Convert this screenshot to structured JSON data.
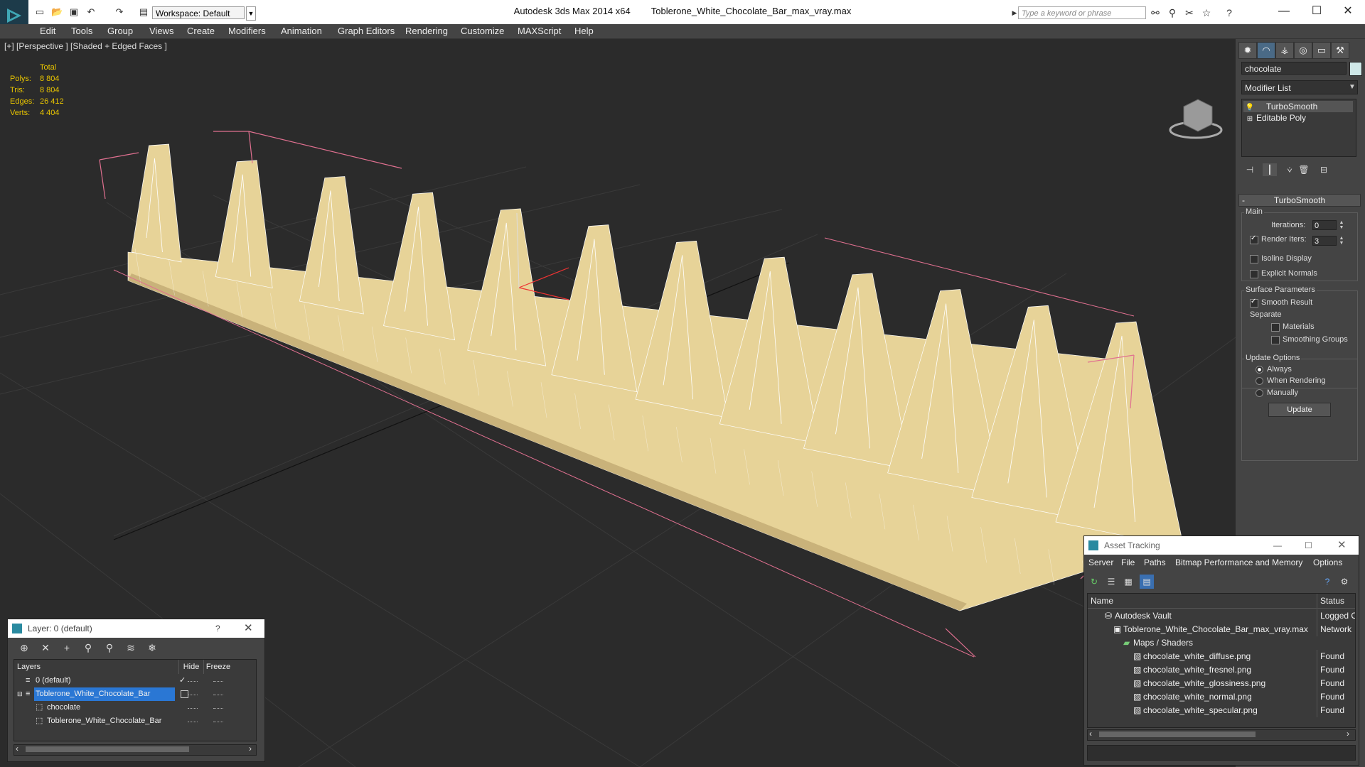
{
  "app": {
    "title": "Autodesk 3ds Max  2014 x64",
    "file": "Toblerone_White_Chocolate_Bar_max_vray.max",
    "workspace": "Workspace: Default",
    "search_placeholder": "Type a keyword or phrase"
  },
  "menu": [
    "Edit",
    "Tools",
    "Group",
    "Views",
    "Create",
    "Modifiers",
    "Animation",
    "Graph Editors",
    "Rendering",
    "Customize",
    "MAXScript",
    "Help"
  ],
  "viewport": {
    "label": "[+] [Perspective ] [Shaded + Edged Faces ]",
    "stats": {
      "header": "Total",
      "rows": [
        {
          "label": "Polys:",
          "value": "8 804"
        },
        {
          "label": "Tris:",
          "value": "8 804"
        },
        {
          "label": "Edges:",
          "value": "26 412"
        },
        {
          "label": "Verts:",
          "value": "4 404"
        }
      ]
    },
    "object_color": "#e7d398"
  },
  "command_panel": {
    "object_name": "chocolate",
    "modifier_list": "Modifier List",
    "stack": [
      "TurboSmooth",
      "Editable Poly"
    ],
    "rollout_title": "TurboSmooth",
    "main_group": "Main",
    "iterations_label": "Iterations:",
    "iterations_value": "0",
    "render_iters_label": "Render Iters:",
    "render_iters_value": "3",
    "isoline_label": "Isoline Display",
    "explicit_normals_label": "Explicit Normals",
    "surface_group": "Surface Parameters",
    "smooth_result_label": "Smooth Result",
    "separate_label": "Separate",
    "materials_label": "Materials",
    "smoothing_groups_label": "Smoothing Groups",
    "update_group": "Update Options",
    "always_label": "Always",
    "when_rendering_label": "When Rendering",
    "manually_label": "Manually",
    "update_button": "Update"
  },
  "layer_dialog": {
    "title": "Layer: 0 (default)",
    "help": "?",
    "columns": {
      "layers": "Layers",
      "hide": "Hide",
      "freeze": "Freeze"
    },
    "rows": [
      "0 (default)",
      "Toblerone_White_Chocolate_Bar",
      "chocolate",
      "Toblerone_White_Chocolate_Bar"
    ]
  },
  "asset_dialog": {
    "title": "Asset Tracking",
    "menu": [
      "Server",
      "File",
      "Paths",
      "Bitmap Performance and Memory",
      "Options"
    ],
    "columns": {
      "name": "Name",
      "status": "Status"
    },
    "rows": [
      {
        "name": "Autodesk Vault",
        "status": "Logged O"
      },
      {
        "name": "Toblerone_White_Chocolate_Bar_max_vray.max",
        "status": "Network"
      },
      {
        "name": "Maps / Shaders",
        "status": ""
      },
      {
        "name": "chocolate_white_diffuse.png",
        "status": "Found"
      },
      {
        "name": "chocolate_white_fresnel.png",
        "status": "Found"
      },
      {
        "name": "chocolate_white_glossiness.png",
        "status": "Found"
      },
      {
        "name": "chocolate_white_normal.png",
        "status": "Found"
      },
      {
        "name": "chocolate_white_specular.png",
        "status": "Found"
      }
    ]
  }
}
